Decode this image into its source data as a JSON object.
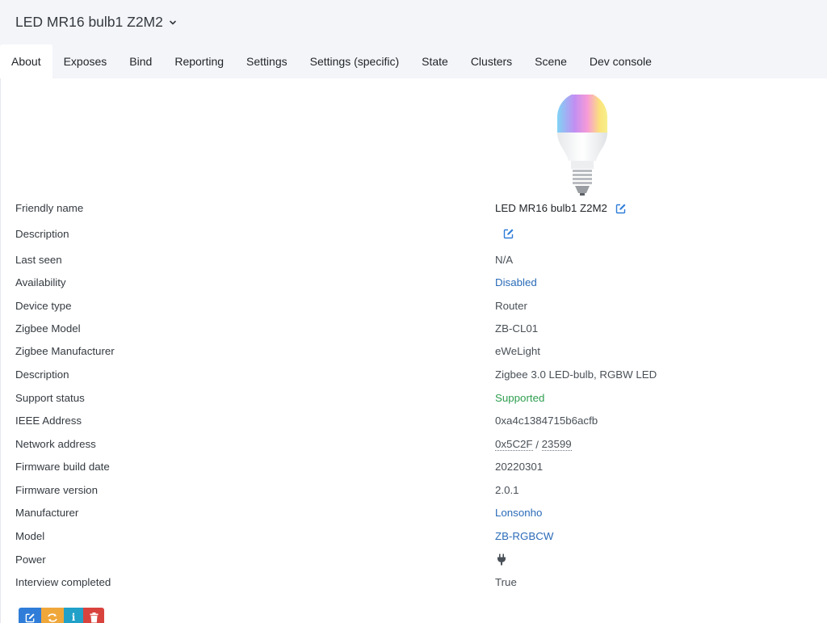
{
  "header": {
    "device_title": "LED MR16 bulb1 Z2M2"
  },
  "tabs": [
    {
      "label": "About",
      "active": true
    },
    {
      "label": "Exposes"
    },
    {
      "label": "Bind"
    },
    {
      "label": "Reporting"
    },
    {
      "label": "Settings"
    },
    {
      "label": "Settings (specific)"
    },
    {
      "label": "State"
    },
    {
      "label": "Clusters"
    },
    {
      "label": "Scene"
    },
    {
      "label": "Dev console"
    }
  ],
  "about": {
    "friendly_name": {
      "label": "Friendly name",
      "value": "LED MR16 bulb1 Z2M2"
    },
    "description": {
      "label": "Description",
      "value": ""
    },
    "last_seen": {
      "label": "Last seen",
      "value": "N/A"
    },
    "availability": {
      "label": "Availability",
      "value": "Disabled"
    },
    "device_type": {
      "label": "Device type",
      "value": "Router"
    },
    "zigbee_model": {
      "label": "Zigbee Model",
      "value": "ZB-CL01"
    },
    "zigbee_manufacturer": {
      "label": "Zigbee Manufacturer",
      "value": "eWeLight"
    },
    "model_description": {
      "label": "Description",
      "value": "Zigbee 3.0 LED-bulb, RGBW LED"
    },
    "support_status": {
      "label": "Support status",
      "value": "Supported"
    },
    "ieee_address": {
      "label": "IEEE Address",
      "value": "0xa4c1384715b6acfb"
    },
    "network_address": {
      "label": "Network address",
      "value_hex": "0x5C2F",
      "separator": " / ",
      "value_dec": "23599"
    },
    "firmware_build_date": {
      "label": "Firmware build date",
      "value": "20220301"
    },
    "firmware_version": {
      "label": "Firmware version",
      "value": "2.0.1"
    },
    "manufacturer": {
      "label": "Manufacturer",
      "value": "Lonsonho"
    },
    "model": {
      "label": "Model",
      "value": "ZB-RGBCW"
    },
    "power": {
      "label": "Power",
      "icon": "plug-icon"
    },
    "interview_completed": {
      "label": "Interview completed",
      "value": "True"
    }
  },
  "actions": {
    "rename_icon": "edit-icon",
    "reconfigure_icon": "refresh-icon",
    "interview_icon": "info-icon",
    "remove_icon": "trash-icon",
    "interview_glyph": "i"
  },
  "colors": {
    "link": "#2a6bb8",
    "supported": "#2e9e4f",
    "btn_blue": "#2f7dd8",
    "btn_orange": "#f0a73a",
    "btn_teal": "#21a0c8",
    "btn_red": "#d9433e"
  }
}
